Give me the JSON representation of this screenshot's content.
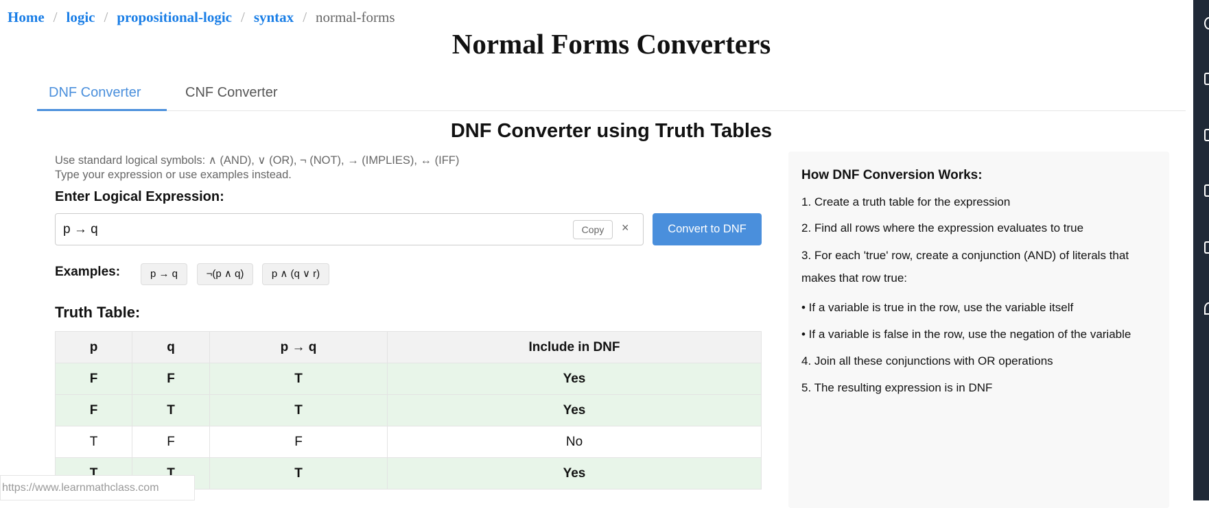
{
  "breadcrumb": {
    "items": [
      "Home",
      "logic",
      "propositional-logic",
      "syntax"
    ],
    "current": "normal-forms"
  },
  "title": "Normal Forms Converters",
  "tabs": [
    {
      "label": "DNF Converter",
      "active": true
    },
    {
      "label": "CNF Converter",
      "active": false
    }
  ],
  "converter": {
    "heading": "DNF Converter using Truth Tables",
    "help": [
      "Use standard logical symbols: ∧ (AND), ∨ (OR), ¬ (NOT), → (IMPLIES), ↔ (IFF)",
      "Type your expression or use examples instead."
    ],
    "input_label": "Enter Logical Expression:",
    "input_value": "p → q",
    "copy_label": "Copy",
    "clear_label": "×",
    "convert_label": "Convert to DNF",
    "examples_label": "Examples:",
    "examples": [
      "p → q",
      "¬(p ∧ q)",
      "p ∧ (q ∨ r)"
    ],
    "table_label": "Truth Table:",
    "table": {
      "headers": [
        "p",
        "q",
        "p → q",
        "Include in DNF"
      ],
      "rows": [
        [
          "F",
          "F",
          "T",
          "Yes"
        ],
        [
          "F",
          "T",
          "T",
          "Yes"
        ],
        [
          "T",
          "F",
          "F",
          "No"
        ],
        [
          "T",
          "T",
          "T",
          "Yes"
        ]
      ]
    }
  },
  "panel": {
    "title": "How DNF Conversion Works:",
    "steps": [
      "1. Create a truth table for the expression",
      "2. Find all rows where the expression evaluates to true",
      "3. For each 'true' row, create a conjunction (AND) of literals that makes that row true:",
      "• If a variable is true in the row, use the variable itself",
      "• If a variable is false in the row, use the negation of the variable",
      "4. Join all these conjunctions with OR operations",
      "5. The resulting expression is in DNF"
    ]
  },
  "status_url": "https://www.learnmathclass.com",
  "colors": {
    "accent": "#4a8fdc",
    "link": "#1a7ee6",
    "yes_row": "#e8f5e9",
    "sidebar": "#1f2937"
  }
}
